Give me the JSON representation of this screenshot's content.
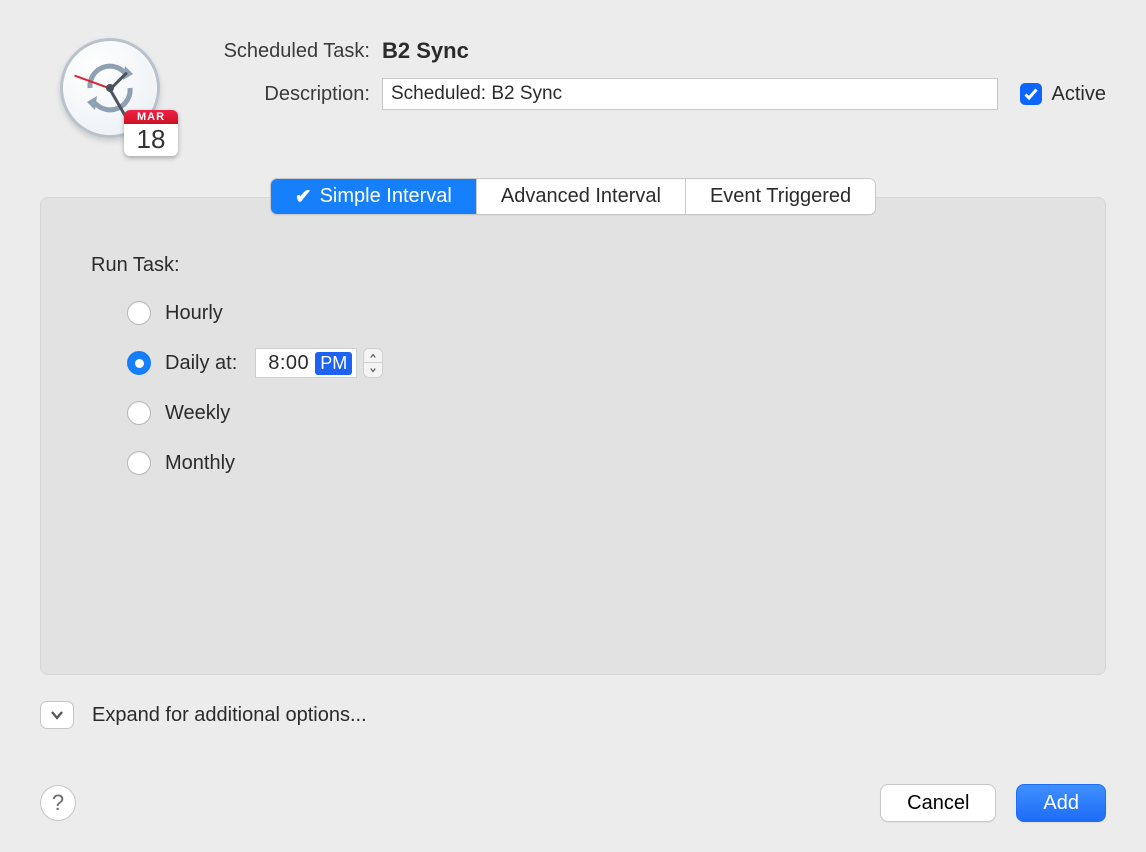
{
  "header": {
    "task_label": "Scheduled Task:",
    "task_name": "B2 Sync",
    "desc_label": "Description:",
    "desc_value": "Scheduled: B2 Sync",
    "active_label": "Active",
    "cal_month": "MAR",
    "cal_day": "18"
  },
  "tabs": {
    "simple": "Simple Interval",
    "advanced": "Advanced Interval",
    "event": "Event Triggered",
    "check": "✔"
  },
  "run": {
    "label": "Run Task:",
    "hourly": "Hourly",
    "daily": "Daily  at:",
    "weekly": "Weekly",
    "monthly": "Monthly",
    "time": "8:00",
    "ampm": "PM"
  },
  "expand": {
    "label": "Expand for additional options..."
  },
  "footer": {
    "help": "?",
    "cancel": "Cancel",
    "add": "Add"
  }
}
